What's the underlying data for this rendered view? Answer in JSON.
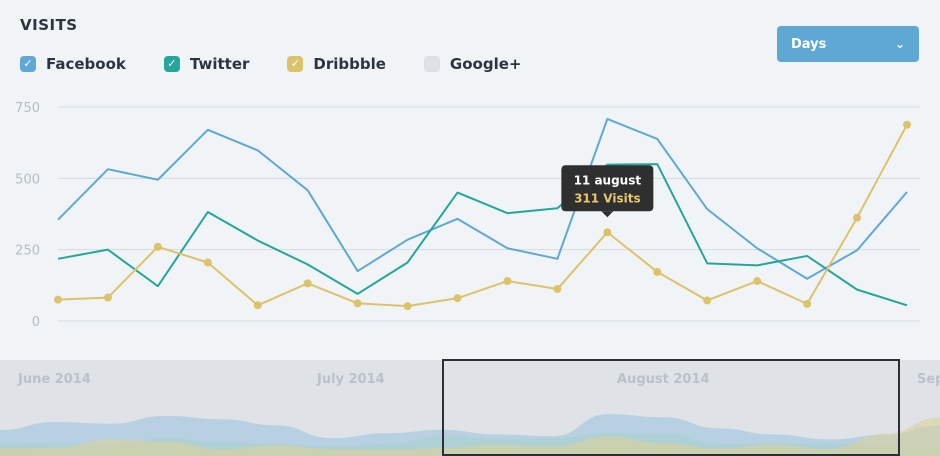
{
  "header": {
    "title": "VISITS"
  },
  "dropdown": {
    "selected": "Days",
    "icon": "chevron-down-icon"
  },
  "legend": [
    {
      "label": "Facebook",
      "checked": true,
      "color": "#5fa8d3"
    },
    {
      "label": "Twitter",
      "checked": true,
      "color": "#26a69a"
    },
    {
      "label": "Dribbble",
      "checked": true,
      "color": "#dcc26b"
    },
    {
      "label": "Google+",
      "checked": false,
      "color": "#dde1e6"
    }
  ],
  "colors": {
    "accent": "#5fa8d3",
    "tooltip_bg": "#2f2f2f",
    "grid": "#d5dbe1"
  },
  "tooltip": {
    "title": "11 august",
    "value": "311 Visits",
    "series": "Dribbble",
    "index": 11
  },
  "navigator": {
    "labels": [
      "June 2014",
      "July 2014",
      "August 2014",
      "Sep"
    ]
  },
  "chart_data": {
    "type": "line",
    "x_count": 18,
    "ylim": [
      0,
      750
    ],
    "yticks": [
      0,
      250,
      500,
      750
    ],
    "grid": true,
    "legend_position": "top-left",
    "series": [
      {
        "name": "Facebook",
        "color": "#5fa8d3",
        "values": [
          355,
          532,
          495,
          670,
          598,
          458,
          175,
          285,
          358,
          255,
          218,
          708,
          638,
          392,
          255,
          148,
          248,
          452
        ]
      },
      {
        "name": "Twitter",
        "color": "#26a69a",
        "values": [
          218,
          250,
          122,
          382,
          282,
          198,
          95,
          205,
          450,
          378,
          395,
          548,
          550,
          202,
          195,
          228,
          110,
          55
        ]
      },
      {
        "name": "Dribbble",
        "color": "#dcc26b",
        "values": [
          75,
          82,
          260,
          205,
          55,
          132,
          62,
          52,
          80,
          140,
          112,
          311,
          172,
          72,
          140,
          60,
          362,
          688
        ]
      }
    ]
  }
}
